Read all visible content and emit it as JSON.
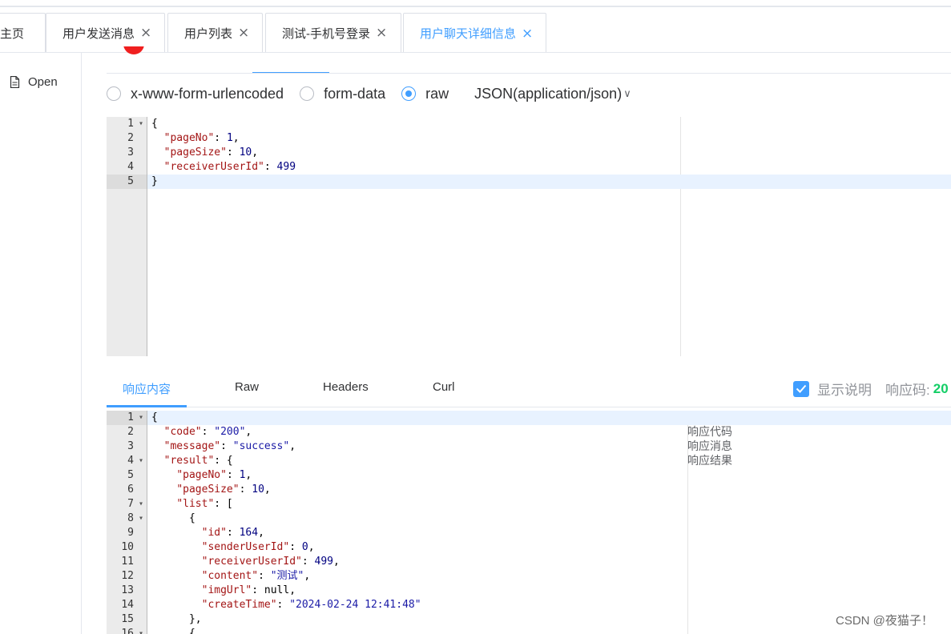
{
  "tabs": [
    {
      "label": "主页",
      "closable": false
    },
    {
      "label": "用户发送消息",
      "closable": true
    },
    {
      "label": "用户列表",
      "closable": true
    },
    {
      "label": "测试-手机号登录",
      "closable": true
    },
    {
      "label": "用户聊天详细信息",
      "closable": true,
      "active": true
    }
  ],
  "tab_close_glyph": "×",
  "sidebar": {
    "open_label": "Open",
    "open_icon": "file-icon"
  },
  "request": {
    "body_types": [
      "x-www-form-urlencoded",
      "form-data",
      "raw"
    ],
    "selected_body_type": "raw",
    "content_type": "JSON(application/json)",
    "body_lines": [
      "{",
      "  \"pageNo\": 1,",
      "  \"pageSize\": 10,",
      "  \"receiverUserId\": 499",
      "}"
    ],
    "line_numbers": [
      "1",
      "2",
      "3",
      "4",
      "5"
    ]
  },
  "response": {
    "tabs": [
      "响应内容",
      "Raw",
      "Headers",
      "Curl"
    ],
    "active_tab": "响应内容",
    "show_desc_label": "显示说明",
    "show_desc_checked": true,
    "status_label": "响应码:",
    "status_value": "20",
    "line_numbers": [
      "1",
      "2",
      "3",
      "4",
      "5",
      "6",
      "7",
      "8",
      "9",
      "10",
      "11",
      "12",
      "13",
      "14",
      "15",
      "16"
    ],
    "descriptions": [
      "响应代码",
      "响应消息",
      "响应结果"
    ]
  },
  "watermark": "CSDN @夜猫子！",
  "colors": {
    "accent": "#409eff",
    "status_green": "#13ce66"
  }
}
